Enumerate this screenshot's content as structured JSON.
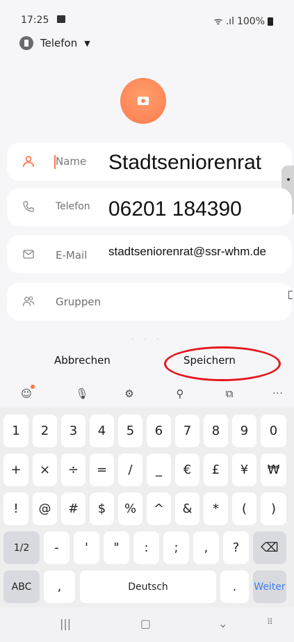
{
  "status_bar": {
    "time": "17:25",
    "wifi_signal": "ᯤ .ıl",
    "battery": "100%"
  },
  "account_selector": {
    "label": "Telefon",
    "dropdown_glyph": "▼"
  },
  "form": {
    "name": {
      "label": "Name",
      "value": "Stadtseniorenrat"
    },
    "phone": {
      "label": "Telefon",
      "value": "06201 184390"
    },
    "email": {
      "label": "E-Mail",
      "value": "stadtseniorenrat@ssr-whm.de"
    },
    "groups": {
      "label": "Gruppen"
    }
  },
  "more_dots": "· · ·",
  "actions": {
    "cancel": "Abbrechen",
    "save": "Speichern"
  },
  "toolbar": {
    "emoji": "☺",
    "mic": "🎙",
    "settings": "⚙",
    "search": "⚲",
    "clipboard": "⧉",
    "more": "···"
  },
  "keyboard": {
    "row1": [
      "1",
      "2",
      "3",
      "4",
      "5",
      "6",
      "7",
      "8",
      "9",
      "0"
    ],
    "row2": [
      "+",
      "×",
      "÷",
      "=",
      "/",
      "_",
      "€",
      "£",
      "¥",
      "₩"
    ],
    "row3": [
      "!",
      "@",
      "#",
      "$",
      "%",
      "^",
      "&",
      "*",
      "(",
      ")"
    ],
    "row4": {
      "mode": "1/2",
      "keys": [
        "-",
        "'",
        "\"",
        ":",
        ";",
        ",",
        "?"
      ],
      "backspace": "⌫"
    },
    "row5": {
      "abc": "ABC",
      "comma": ",",
      "space": "Deutsch",
      "period": ".",
      "enter": "Weiter"
    }
  },
  "nav_bar": {
    "recents": "|||",
    "home": "▢",
    "back": "⌄",
    "keyboard": "⠿"
  },
  "colors": {
    "accent": "#ff7b4f",
    "highlight_ring": "#e4161b",
    "enter_key": "#3b7df0"
  }
}
